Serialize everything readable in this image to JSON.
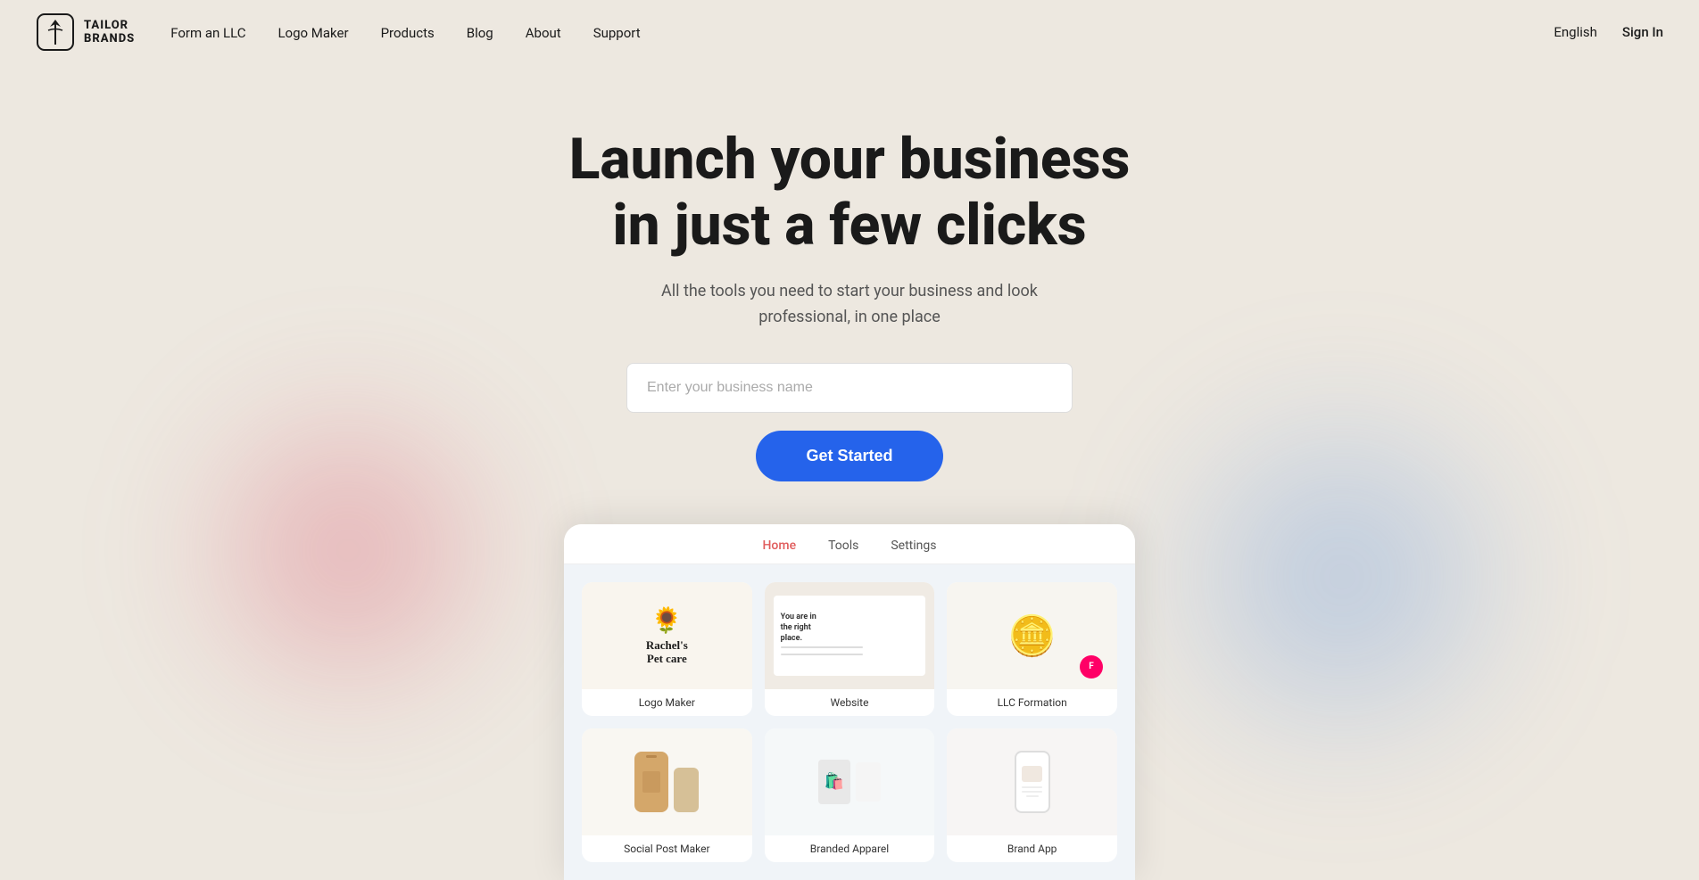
{
  "brand": {
    "name_line1": "TAILOR",
    "name_line2": "BRANDS",
    "tagline": "TAILOR BRANDS"
  },
  "nav": {
    "links": [
      {
        "label": "Form an LLC",
        "id": "form-llc"
      },
      {
        "label": "Logo Maker",
        "id": "logo-maker"
      },
      {
        "label": "Products",
        "id": "products"
      },
      {
        "label": "Blog",
        "id": "blog"
      },
      {
        "label": "About",
        "id": "about"
      },
      {
        "label": "Support",
        "id": "support"
      }
    ],
    "lang": "English",
    "signin": "Sign In"
  },
  "hero": {
    "title_line1": "Launch your business",
    "title_line2": "in just a few clicks",
    "subtitle": "All the tools you need to start your business and look professional, in one place",
    "input_placeholder": "Enter your business name",
    "cta_label": "Get Started"
  },
  "dashboard": {
    "tabs": [
      {
        "label": "Home",
        "active": true
      },
      {
        "label": "Tools",
        "active": false
      },
      {
        "label": "Settings",
        "active": false
      }
    ],
    "cards": [
      {
        "label": "Logo Maker",
        "type": "logo"
      },
      {
        "label": "Website",
        "type": "website"
      },
      {
        "label": "LLC Formation",
        "type": "llc"
      },
      {
        "label": "Social Post Maker",
        "type": "social"
      },
      {
        "label": "Branded Apparel",
        "type": "branded"
      },
      {
        "label": "Brand App",
        "type": "app"
      }
    ]
  }
}
